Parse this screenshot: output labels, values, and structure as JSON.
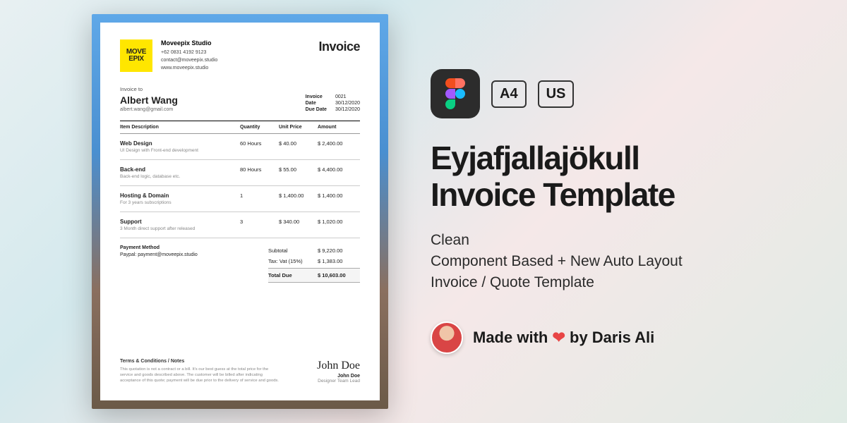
{
  "invoice": {
    "logo1": "MOVE",
    "logo2": "EPIX",
    "company": "Moveepix Studio",
    "phone": "+62 0831 4192 9123",
    "email": "contact@moveepix.studio",
    "web": "www.moveepix.studio",
    "docTitle": "Invoice",
    "billLabel": "Invoice to",
    "billName": "Albert Wang",
    "billEmail": "albert.wang@gmail.com",
    "meta": {
      "k1": "Invoice",
      "v1": "0021",
      "k2": "Date",
      "v2": "30/12/2020",
      "k3": "Due Date",
      "v3": "30/12/2020"
    },
    "headers": {
      "c1": "Item Description",
      "c2": "Quantity",
      "c3": "Unit Price",
      "c4": "Amount"
    },
    "items": [
      {
        "name": "Web Design",
        "desc": "UI Design with Front-end development",
        "qty": "60 Hours",
        "price": "$ 40.00",
        "amount": "$ 2,400.00"
      },
      {
        "name": "Back-end",
        "desc": "Back-end logic, database etc.",
        "qty": "80 Hours",
        "price": "$ 55.00",
        "amount": "$ 4,400.00"
      },
      {
        "name": "Hosting & Domain",
        "desc": "For 3 years subscriptions",
        "qty": "1",
        "price": "$ 1,400.00",
        "amount": "$ 1,400.00"
      },
      {
        "name": "Support",
        "desc": "3 Month direct support after released",
        "qty": "3",
        "price": "$ 340.00",
        "amount": "$ 1,020.00"
      }
    ],
    "payment": {
      "label": "Payment Method",
      "value": "Paypal: payment@moveepix.studio"
    },
    "totals": {
      "k1": "Subtotal",
      "v1": "$ 9,220.00",
      "k2": "Tax: Vat (15%)",
      "v2": "$ 1,383.00",
      "k3": "Total Due",
      "v3": "$ 10,603.00"
    },
    "terms": {
      "h": "Terms & Conditions / Notes",
      "body": "This quotation is not a contract or a bill. It's our best guess at the total price for the service and goods described above. The customer will be billed after indicating acceptance of this quote; payment will be due prior to the delivery of service and goods."
    },
    "sign": {
      "sig": "John Doe",
      "name": "John Doe",
      "role": "Designer Team Lead"
    }
  },
  "promo": {
    "badgeA4": "A4",
    "badgeUS": "US",
    "title1": "Eyjafjallajökull",
    "title2": "Invoice Template",
    "sub1": "Clean",
    "sub2": "Component Based + New Auto Layout",
    "sub3": "Invoice / Quote Template",
    "authorPrefix": "Made with ",
    "authorSuffix": " by Daris Ali"
  }
}
